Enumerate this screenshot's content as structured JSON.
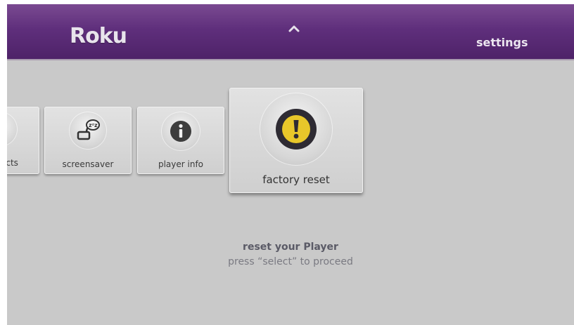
{
  "header": {
    "logo": "Roku",
    "section_title": "settings",
    "nav_icon": "up-arrow-icon"
  },
  "menu": {
    "items": [
      {
        "label": "ects",
        "icon": "effects-icon"
      },
      {
        "label": "screensaver",
        "icon": "screensaver-icon"
      },
      {
        "label": "player info",
        "icon": "info-icon"
      },
      {
        "label": "factory reset",
        "icon": "warning-icon",
        "selected": true
      }
    ]
  },
  "message": {
    "title": "reset your Player",
    "subtitle": "press “select” to proceed"
  },
  "colors": {
    "header_purple": "#5f2f7c",
    "background": "#c9c9c9",
    "warning_yellow": "#e8c72a"
  }
}
